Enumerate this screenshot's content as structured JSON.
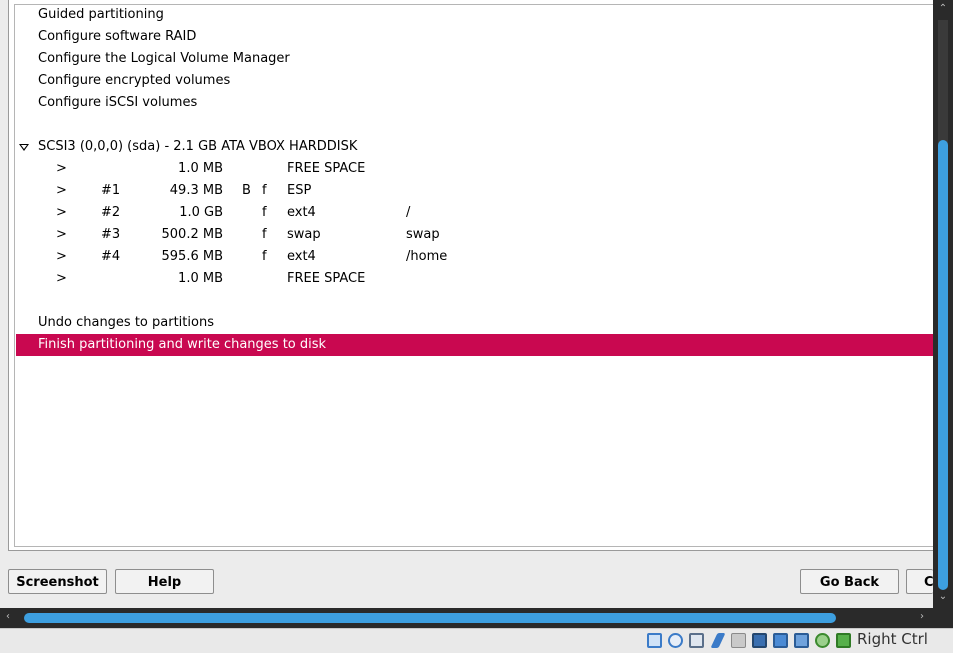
{
  "menu": {
    "items": [
      "Guided partitioning",
      "Configure software RAID",
      "Configure the Logical Volume Manager",
      "Configure encrypted volumes",
      "Configure iSCSI volumes"
    ]
  },
  "disk": {
    "label": "SCSI3 (0,0,0) (sda) - 2.1 GB ATA VBOX HARDDISK",
    "partitions": [
      {
        "arrow": ">",
        "num": "",
        "size": "1.0 MB",
        "bootable": "",
        "format": "",
        "fs": "FREE SPACE",
        "mount": ""
      },
      {
        "arrow": ">",
        "num": "#1",
        "size": "49.3 MB",
        "bootable": "B",
        "format": "f",
        "fs": "ESP",
        "mount": ""
      },
      {
        "arrow": ">",
        "num": "#2",
        "size": "1.0 GB",
        "bootable": "",
        "format": "f",
        "fs": "ext4",
        "mount": "/"
      },
      {
        "arrow": ">",
        "num": "#3",
        "size": "500.2 MB",
        "bootable": "",
        "format": "f",
        "fs": "swap",
        "mount": "swap"
      },
      {
        "arrow": ">",
        "num": "#4",
        "size": "595.6 MB",
        "bootable": "",
        "format": "f",
        "fs": "ext4",
        "mount": "/home"
      },
      {
        "arrow": ">",
        "num": "",
        "size": "1.0 MB",
        "bootable": "",
        "format": "",
        "fs": "FREE SPACE",
        "mount": ""
      }
    ]
  },
  "actions": {
    "undo": "Undo changes to partitions",
    "finish": "Finish partitioning and write changes to disk"
  },
  "buttons": {
    "screenshot": "Screenshot",
    "help": "Help",
    "go_back": "Go Back",
    "continue_partial": "C"
  },
  "statusbar": {
    "host_key": "Right Ctrl",
    "icons": [
      "hard-disk-icon",
      "optical-drive-icon",
      "audio-icon",
      "usb-icon",
      "shared-folders-icon",
      "display-icon",
      "network-icon",
      "video-capture-icon",
      "cpu-icon",
      "mouse-integration-icon",
      "keyboard-capture-icon"
    ]
  },
  "colors": {
    "selection": "#c90850",
    "scroll_thumb": "#3d9fe0"
  }
}
